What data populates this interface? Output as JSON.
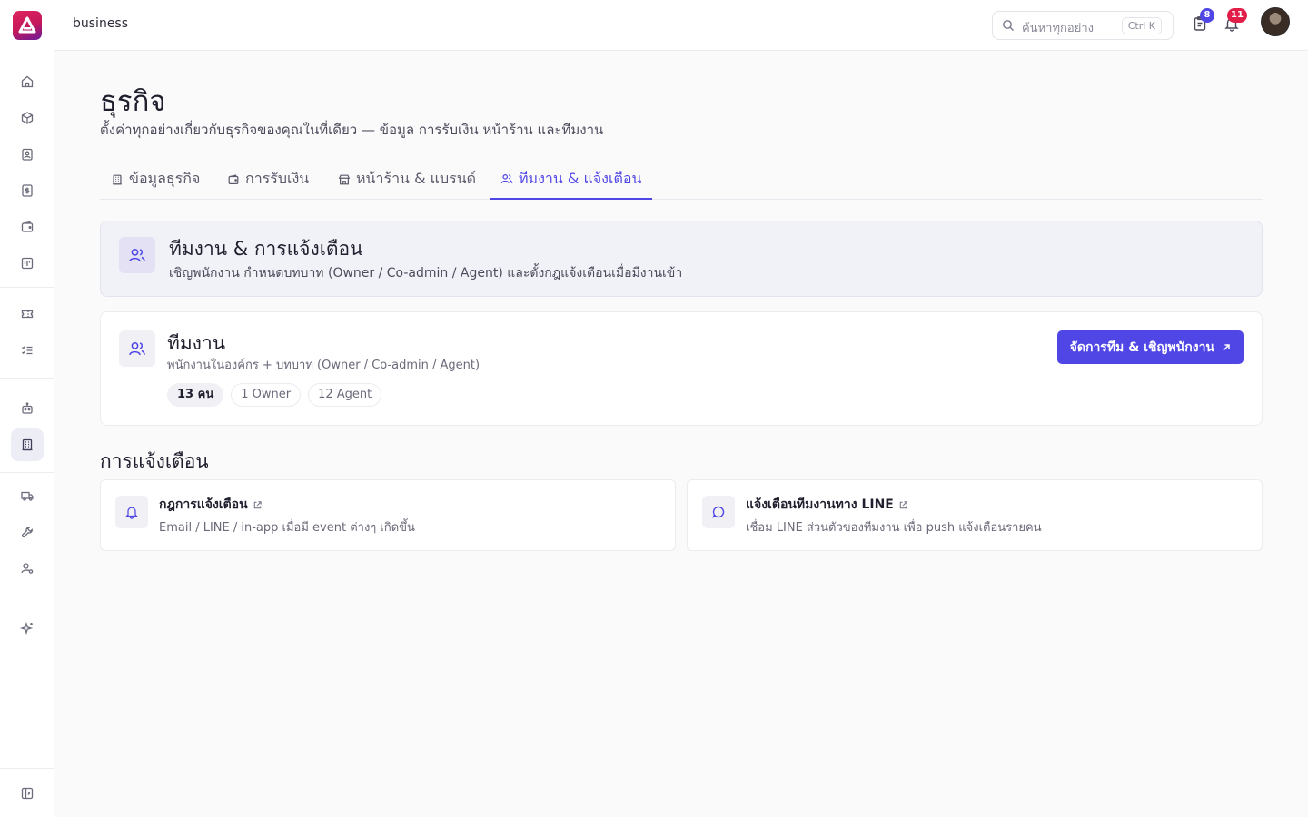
{
  "colors": {
    "accent": "#4f46e5",
    "badge_tasks": "#4f46e5",
    "badge_bell": "#e11d48"
  },
  "sidebar": {
    "items": [
      {
        "icon": "home-icon"
      },
      {
        "icon": "box-icon"
      },
      {
        "icon": "contact-icon"
      },
      {
        "icon": "receipt-icon"
      },
      {
        "icon": "wallet-icon"
      },
      {
        "icon": "board-icon"
      },
      {
        "icon": "ticket-icon"
      },
      {
        "icon": "checklist-icon"
      },
      {
        "icon": "bot-icon"
      },
      {
        "icon": "building-icon",
        "active": true
      },
      {
        "icon": "truck-icon"
      },
      {
        "icon": "wrench-icon"
      },
      {
        "icon": "user-settings-icon"
      },
      {
        "icon": "sparkles-icon"
      },
      {
        "icon": "collapse-sidebar-icon"
      }
    ]
  },
  "topbar": {
    "breadcrumb": "business",
    "search": {
      "placeholder": "ค้นหาทุกอย่าง",
      "shortcut": "Ctrl K"
    },
    "tasks_badge": "8",
    "bell_badge": "11"
  },
  "page": {
    "title": "ธุรกิจ",
    "subtitle": "ตั้งค่าทุกอย่างเกี่ยวกับธุรกิจของคุณในที่เดียว — ข้อมูล การรับเงิน หน้าร้าน และทีมงาน"
  },
  "tabs": [
    {
      "label": "ข้อมูลธุรกิจ"
    },
    {
      "label": "การรับเงิน"
    },
    {
      "label": "หน้าร้าน & แบรนด์"
    },
    {
      "label": "ทีมงาน & แจ้งเตือน",
      "active": true
    }
  ],
  "hero": {
    "title": "ทีมงาน & การแจ้งเตือน",
    "subtitle": "เชิญพนักงาน กำหนดบทบาท (Owner / Co-admin / Agent) และตั้งกฎแจ้งเตือนเมื่อมีงานเข้า"
  },
  "team": {
    "title": "ทีมงาน",
    "subtitle": "พนักงานในองค์กร + บทบาท (Owner / Co-admin / Agent)",
    "pills": [
      "13 คน",
      "1 Owner",
      "12 Agent"
    ],
    "button": "จัดการทีม & เชิญพนักงาน"
  },
  "notifications": {
    "section_title": "การแจ้งเตือน",
    "cards": [
      {
        "title": "กฎการแจ้งเตือน",
        "subtitle": "Email / LINE / in-app เมื่อมี event ต่างๆ เกิดขึ้น"
      },
      {
        "title": "แจ้งเตือนทีมงานทาง LINE",
        "subtitle": "เชื่อม LINE ส่วนตัวของทีมงาน เพื่อ push แจ้งเตือนรายคน"
      }
    ]
  }
}
